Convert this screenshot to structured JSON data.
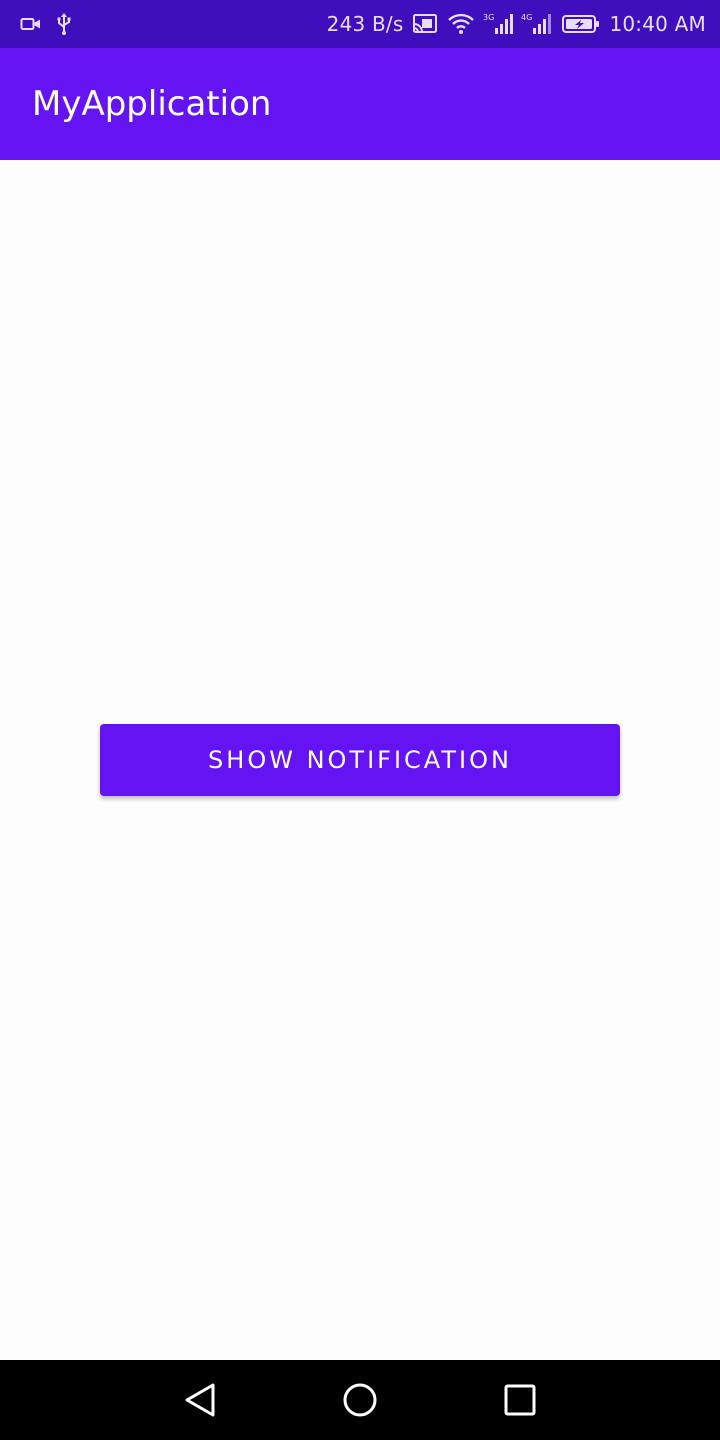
{
  "status_bar": {
    "net_speed": "243 B/s",
    "time": "10:40 AM",
    "icons": [
      "video-camera-icon",
      "usb-icon",
      "cast-icon",
      "wifi-icon",
      "signal-3g-icon",
      "signal-4g-icon",
      "battery-charging-icon"
    ]
  },
  "app_bar": {
    "title": "MyApplication"
  },
  "main": {
    "button_label": "SHOW NOTIFICATION"
  },
  "nav_bar": {
    "icons": [
      "back-icon",
      "home-icon",
      "recents-icon"
    ]
  },
  "colors": {
    "status_bar": "#3f0ebd",
    "primary": "#6414f2",
    "background": "#fcfdfc",
    "nav_bar": "#000000"
  }
}
